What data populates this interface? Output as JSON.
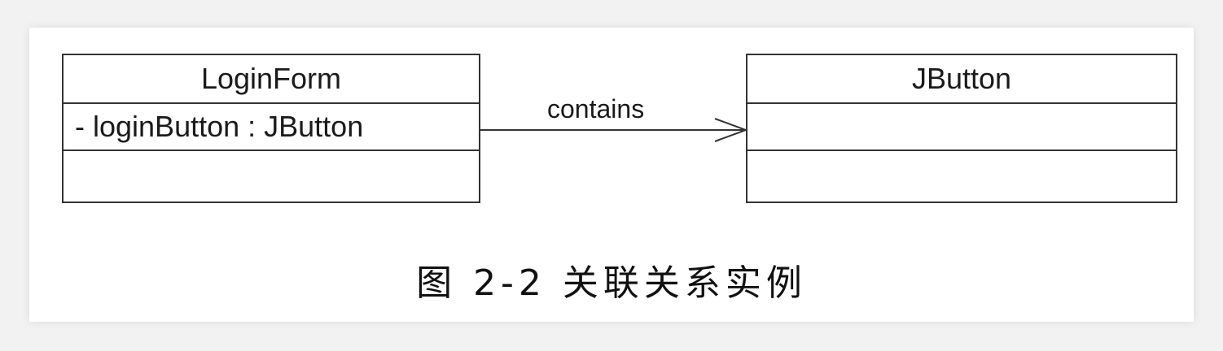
{
  "diagram": {
    "classes": [
      {
        "name": "LoginForm",
        "attributes": [
          "- loginButton : JButton"
        ],
        "operations": []
      },
      {
        "name": "JButton",
        "attributes": [],
        "operations": []
      }
    ],
    "association": {
      "label": "contains",
      "from": "LoginForm",
      "to": "JButton",
      "navigable_to_target": true
    }
  },
  "caption": "图 2-2  关联关系实例"
}
